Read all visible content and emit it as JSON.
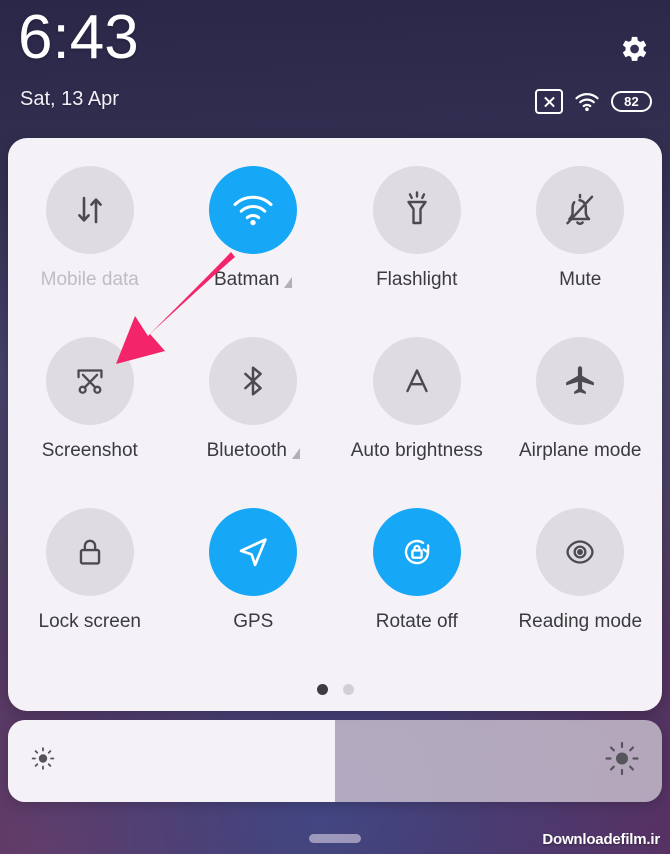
{
  "status_bar": {
    "time": "6:43",
    "date": "Sat, 13 Apr",
    "battery_percent": "82",
    "icons": {
      "settings": "gear-icon",
      "sim": "sim-card-disabled-icon",
      "wifi": "wifi-icon",
      "battery": "battery-icon"
    }
  },
  "quick_settings": {
    "tiles": [
      {
        "label": "Mobile data",
        "icon": "mobile-data-icon",
        "active": false,
        "disabled": true,
        "expandable": false
      },
      {
        "label": "Batman",
        "icon": "wifi-icon",
        "active": true,
        "disabled": false,
        "expandable": true
      },
      {
        "label": "Flashlight",
        "icon": "flashlight-icon",
        "active": false,
        "disabled": false,
        "expandable": false
      },
      {
        "label": "Mute",
        "icon": "bell-mute-icon",
        "active": false,
        "disabled": false,
        "expandable": false
      },
      {
        "label": "Screenshot",
        "icon": "screenshot-icon",
        "active": false,
        "disabled": false,
        "expandable": false
      },
      {
        "label": "Bluetooth",
        "icon": "bluetooth-icon",
        "active": false,
        "disabled": false,
        "expandable": true
      },
      {
        "label": "Auto brightness",
        "icon": "auto-brightness-icon",
        "active": false,
        "disabled": false,
        "expandable": false
      },
      {
        "label": "Airplane mode",
        "icon": "airplane-icon",
        "active": false,
        "disabled": false,
        "expandable": false
      },
      {
        "label": "Lock screen",
        "icon": "lock-icon",
        "active": false,
        "disabled": false,
        "expandable": false
      },
      {
        "label": "GPS",
        "icon": "location-arrow-icon",
        "active": true,
        "disabled": false,
        "expandable": false
      },
      {
        "label": "Rotate off",
        "icon": "rotation-lock-icon",
        "active": true,
        "disabled": false,
        "expandable": false
      },
      {
        "label": "Reading mode",
        "icon": "eye-icon",
        "active": false,
        "disabled": false,
        "expandable": false
      }
    ],
    "pages": {
      "count": 2,
      "current": 1
    }
  },
  "brightness_slider": {
    "value_percent": 50,
    "low_icon": "brightness-low-icon",
    "high_icon": "brightness-high-icon"
  },
  "annotation": {
    "arrow_color": "#f4246b",
    "points_to": "Screenshot"
  },
  "watermark": {
    "text": "Downloadefilm.ir"
  },
  "colors": {
    "accent_active": "#16a7f7",
    "tile_inactive": "#dedce1",
    "panel_bg": "#f4f2f6",
    "label": "#3b3b3f",
    "label_disabled": "#bfbdc4",
    "arrow": "#f4246b"
  }
}
